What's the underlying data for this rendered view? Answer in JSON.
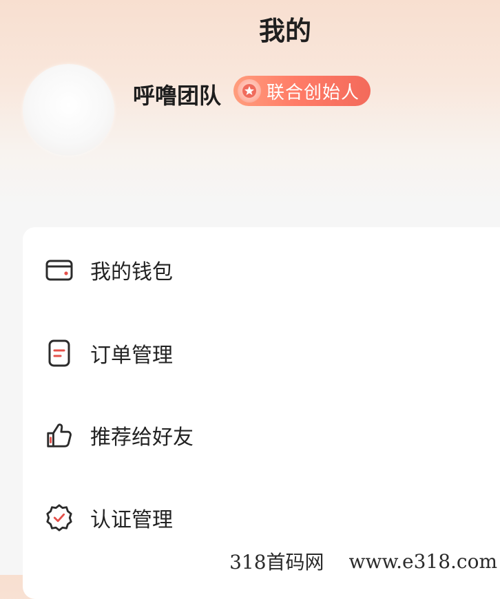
{
  "header": {
    "title": "我的"
  },
  "profile": {
    "username": "呼噜团队",
    "badge": "联合创始人",
    "badge_icon": "star-medal-icon"
  },
  "menu": {
    "items": [
      {
        "label": "我的钱包",
        "icon": "wallet-icon"
      },
      {
        "label": "订单管理",
        "icon": "order-document-icon"
      },
      {
        "label": "推荐给好友",
        "icon": "thumbs-up-icon"
      },
      {
        "label": "认证管理",
        "icon": "verified-badge-icon"
      }
    ]
  },
  "watermark": {
    "left": "318首码网",
    "right": "www.e318.com"
  },
  "colors": {
    "accent": "#e4504a",
    "badge_start": "#ff9d7d",
    "badge_end": "#f36a5b",
    "icon_stroke": "#2b2b2b"
  }
}
